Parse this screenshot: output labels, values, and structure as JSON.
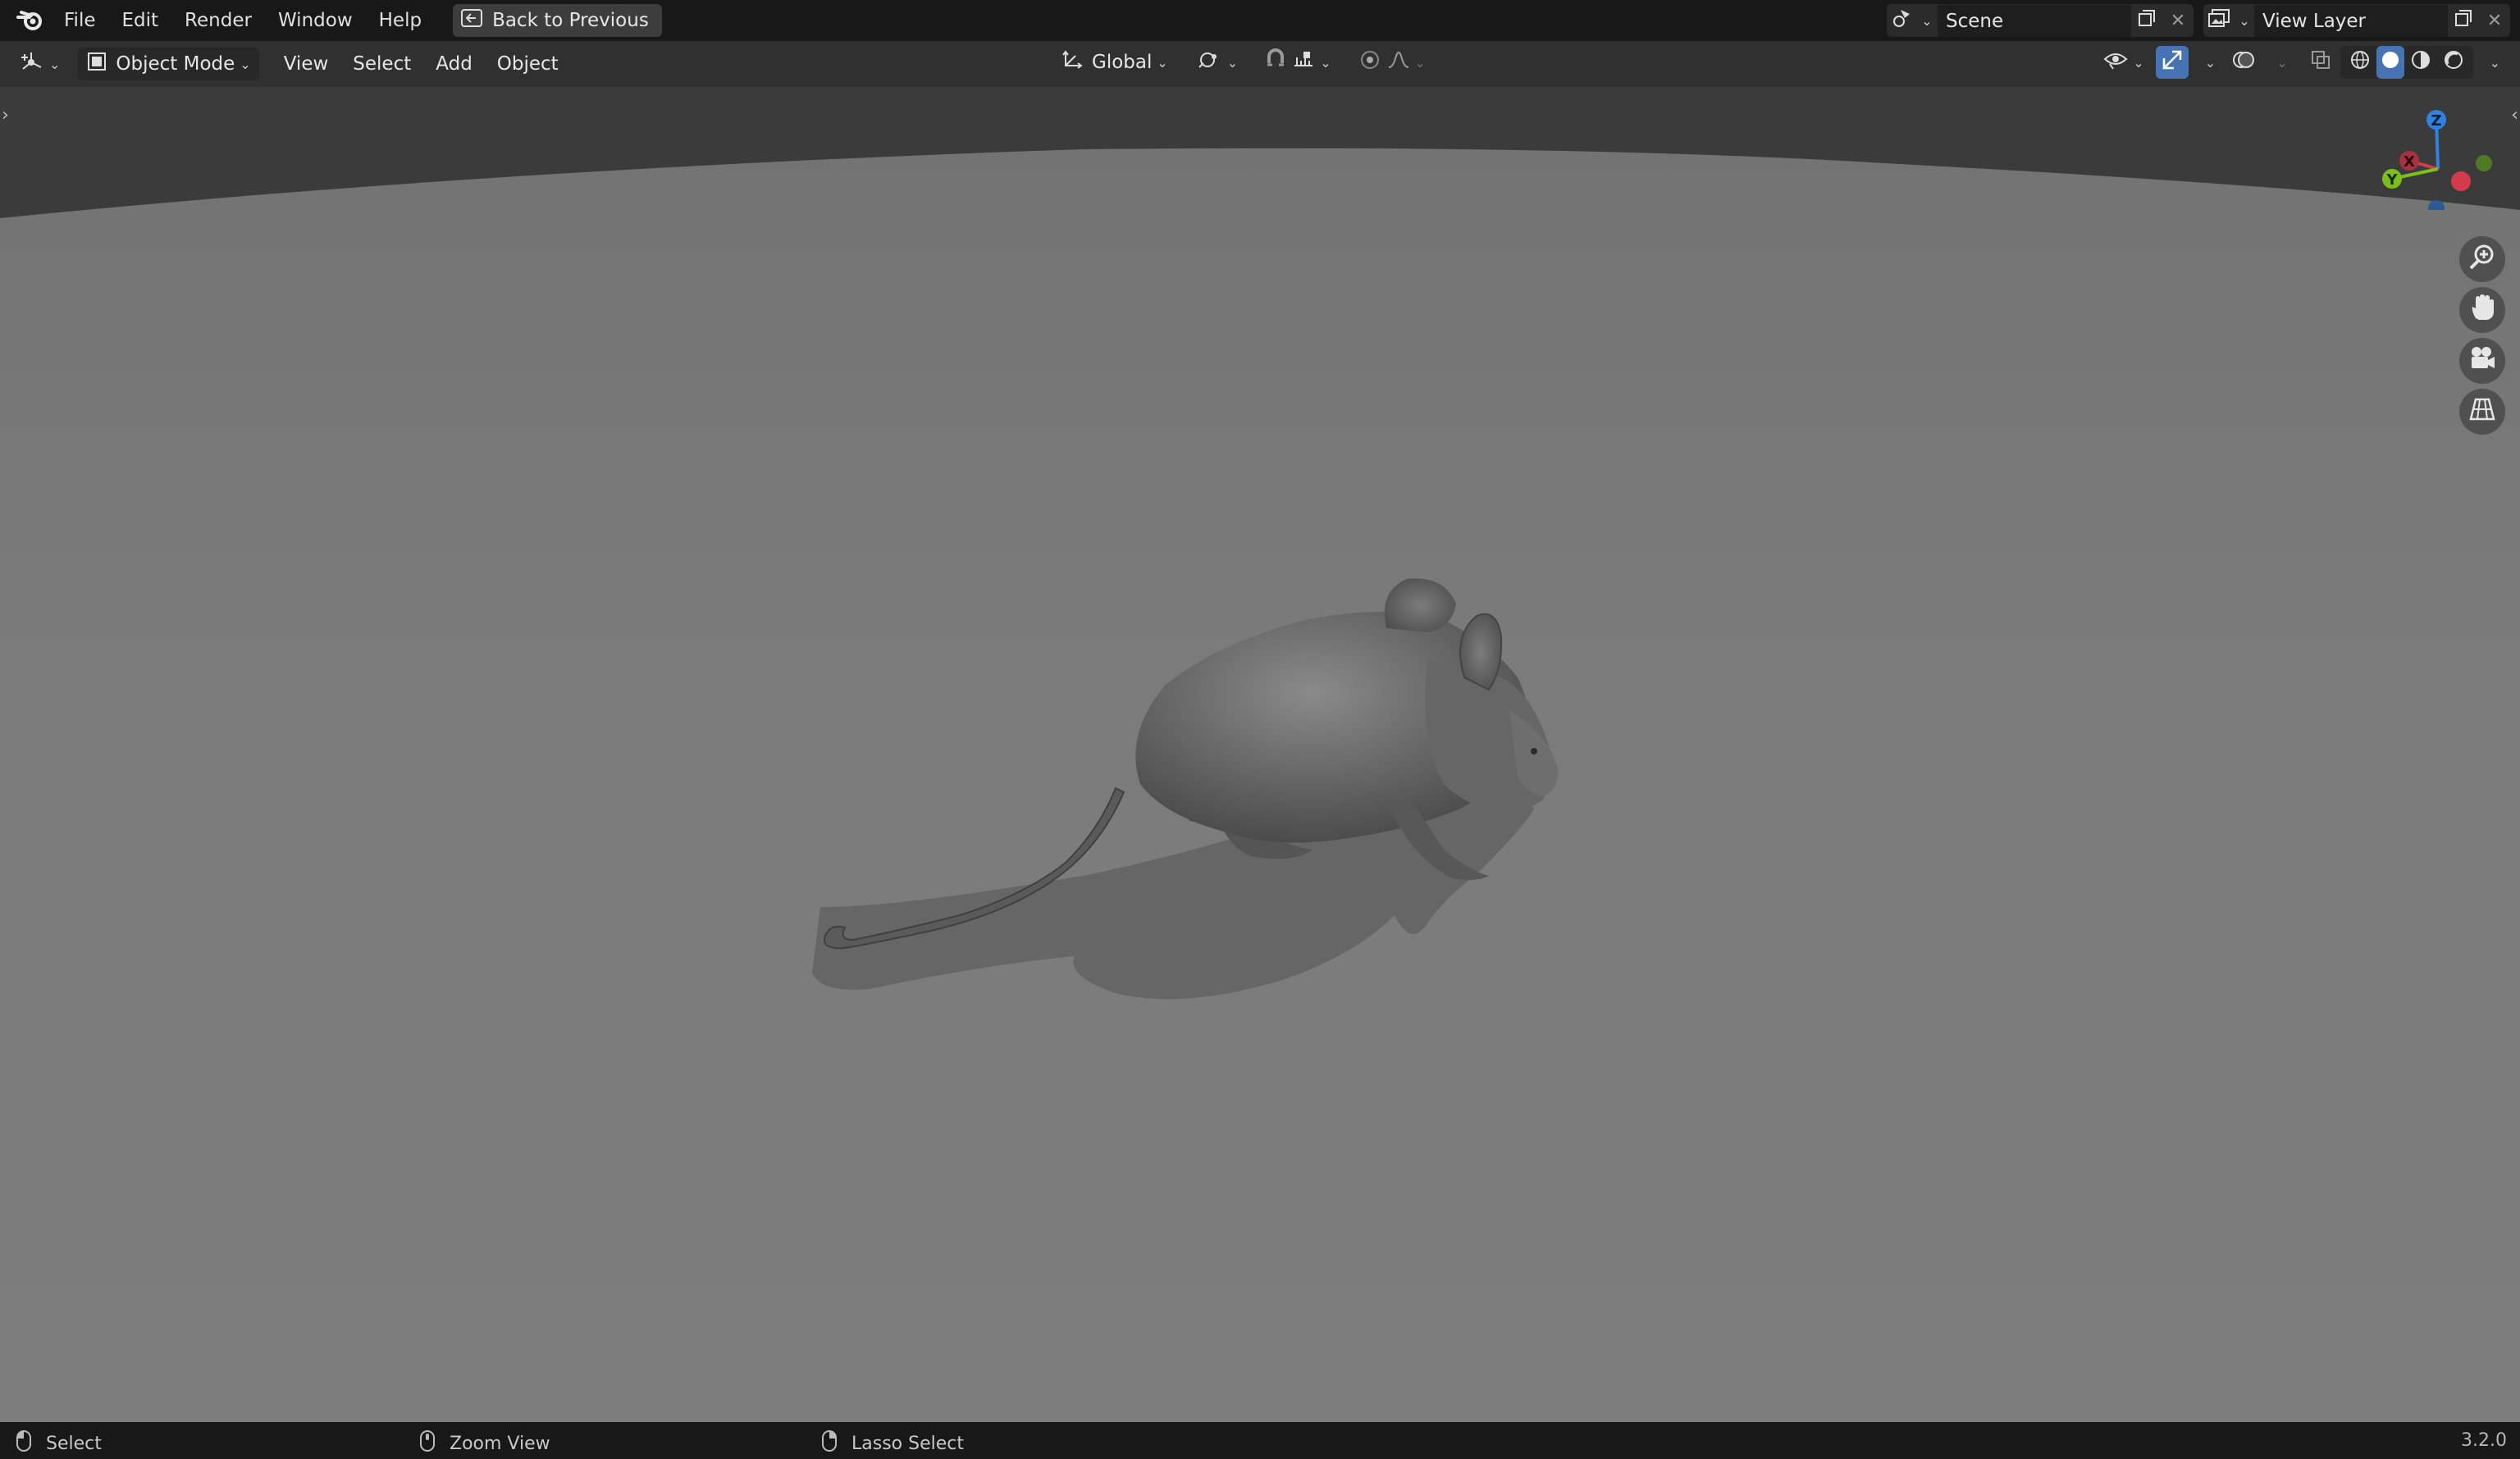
{
  "topbar": {
    "menus": [
      "File",
      "Edit",
      "Render",
      "Window",
      "Help"
    ],
    "back_button": "Back to Previous",
    "scene_name": "Scene",
    "view_layer_name": "View Layer"
  },
  "header": {
    "mode": "Object Mode",
    "menus": [
      "View",
      "Select",
      "Add",
      "Object"
    ],
    "transform_orientation": "Global"
  },
  "gizmo": {
    "axes": [
      "Z",
      "X",
      "Y"
    ],
    "colors": {
      "x": "#d33b4c",
      "y": "#7bbf1e",
      "z": "#2f82e0"
    }
  },
  "viewport_tools": [
    "zoom-icon",
    "hand-pan-icon",
    "camera-icon",
    "grid-ortho-icon"
  ],
  "statusbar": {
    "left_action": "Select",
    "middle_action": "Zoom View",
    "right_action": "Lasso Select",
    "version": "3.2.0"
  },
  "colors": {
    "accent": "#4772b3",
    "floor": "#7a7a7a",
    "background": "#3a3a3a"
  }
}
